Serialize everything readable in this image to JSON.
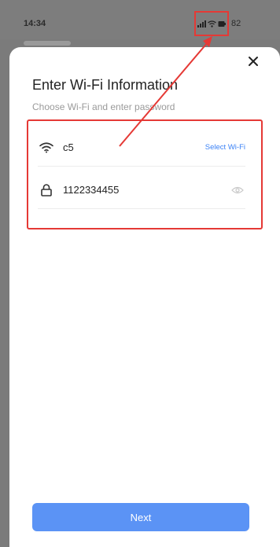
{
  "status_bar": {
    "time": "14:34",
    "battery": "82"
  },
  "sheet": {
    "title": "Enter Wi-Fi Information",
    "subtitle": "Choose Wi-Fi and enter password",
    "wifi": {
      "ssid": "c5",
      "select_label": "Select Wi-Fi"
    },
    "password": {
      "value": "1122334455"
    },
    "next_label": "Next"
  },
  "colors": {
    "accent": "#5b93f5",
    "link": "#3b82f6",
    "annotation": "#e53935"
  },
  "icons": {
    "close": "close-icon",
    "wifi": "wifi-icon",
    "lock": "lock-icon",
    "eye": "eye-icon"
  }
}
